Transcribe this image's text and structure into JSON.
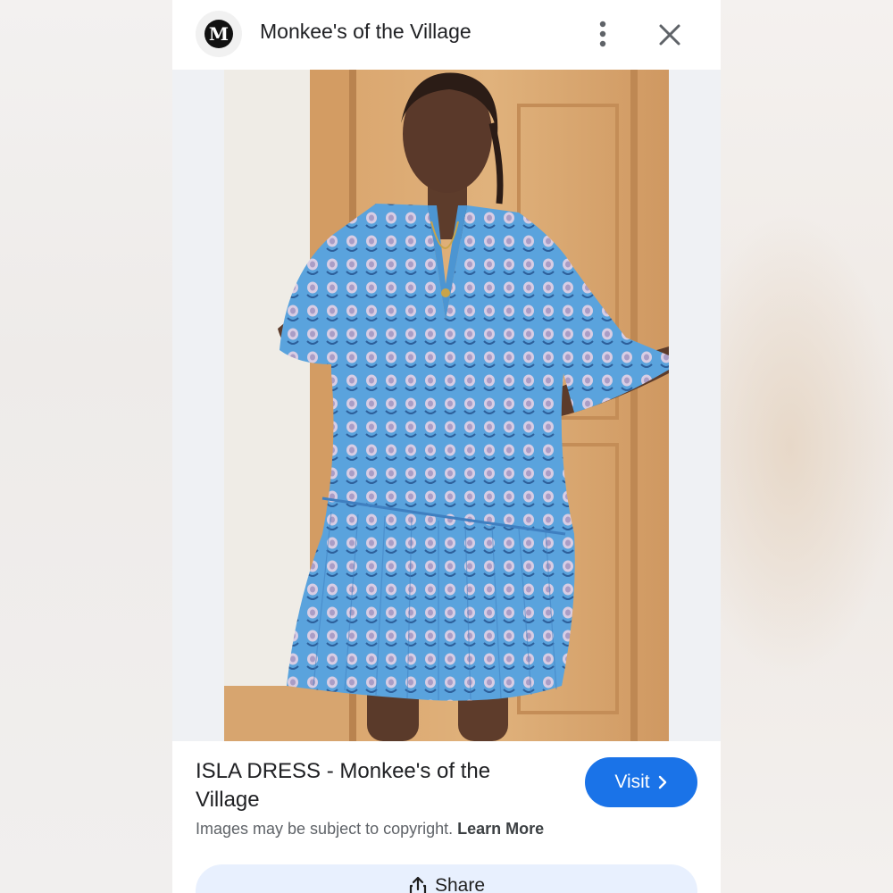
{
  "header": {
    "site_name": "Monkee's of the Village",
    "logo_letter": "M"
  },
  "image": {
    "subject": "woman in blue printed tiered dress"
  },
  "caption": {
    "title": "ISLA DRESS - Monkee's of the Village",
    "copyright_text": "Images may be subject to copyright.",
    "learn_more_label": "Learn More"
  },
  "actions": {
    "visit_label": "Visit",
    "share_label": "Share"
  },
  "colors": {
    "accent": "#1a73e8",
    "share_bg": "#e8f0fe",
    "dress_blue": "#5aa3dd"
  },
  "icons": [
    "logo-icon",
    "more-vert-icon",
    "close-icon",
    "chevron-right-icon",
    "share-icon"
  ]
}
